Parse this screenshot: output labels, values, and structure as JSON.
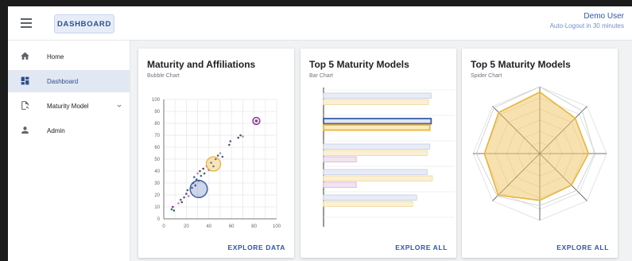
{
  "header": {
    "menu_icon": "hamburger-menu-icon",
    "dashboard_button": "DASHBOARD",
    "user_name": "Demo User",
    "auto_logout": "Auto-Logout in 30 minutes"
  },
  "sidebar": {
    "items": [
      {
        "label": "Home",
        "icon": "home-icon",
        "active": false
      },
      {
        "label": "Dashboard",
        "icon": "dashboard-icon",
        "active": true
      },
      {
        "label": "Maturity Model",
        "icon": "assessment-icon",
        "active": false,
        "expandable": true
      },
      {
        "label": "Admin",
        "icon": "person-icon",
        "active": false
      }
    ]
  },
  "cards": [
    {
      "title": "Maturity and Affiliations",
      "subtitle": "Bubble Chart",
      "action": "EXPLORE DATA"
    },
    {
      "title": "Top 5 Maturity Models",
      "subtitle": "Bar Chart",
      "action": "EXPLORE ALL"
    },
    {
      "title": "Top 5 Maturity Models",
      "subtitle": "Spider Chart",
      "action": "EXPLORE ALL"
    }
  ],
  "colors": {
    "accent": "#2d56a8",
    "blue_series": "#3c5ea8",
    "yellow_series": "#e8b53a",
    "purple": "#7b2a8f",
    "pink": "#c97ab7"
  },
  "chart_data": [
    {
      "type": "scatter",
      "xlim": [
        0,
        100
      ],
      "ylim": [
        0,
        100
      ],
      "x_ticks": [
        0,
        20,
        40,
        60,
        80,
        100
      ],
      "y_ticks": [
        0,
        10,
        20,
        30,
        40,
        50,
        60,
        70,
        80,
        90,
        100
      ],
      "grid": true,
      "points": [
        {
          "x": 7,
          "y": 8,
          "r": 1
        },
        {
          "x": 8,
          "y": 10,
          "r": 1
        },
        {
          "x": 9,
          "y": 7,
          "r": 1
        },
        {
          "x": 13,
          "y": 13,
          "r": 1
        },
        {
          "x": 15,
          "y": 16,
          "r": 1
        },
        {
          "x": 16,
          "y": 14,
          "r": 1
        },
        {
          "x": 18,
          "y": 18,
          "r": 1
        },
        {
          "x": 20,
          "y": 21,
          "r": 1
        },
        {
          "x": 21,
          "y": 24,
          "r": 1
        },
        {
          "x": 22,
          "y": 19,
          "r": 1
        },
        {
          "x": 25,
          "y": 26,
          "r": 1
        },
        {
          "x": 26,
          "y": 30,
          "r": 1
        },
        {
          "x": 27,
          "y": 35,
          "r": 1
        },
        {
          "x": 28,
          "y": 28,
          "r": 1
        },
        {
          "x": 29,
          "y": 33,
          "r": 1
        },
        {
          "x": 30,
          "y": 38,
          "r": 1
        },
        {
          "x": 31,
          "y": 32,
          "r": 1
        },
        {
          "x": 32,
          "y": 40,
          "r": 1
        },
        {
          "x": 33,
          "y": 36,
          "r": 1
        },
        {
          "x": 35,
          "y": 42,
          "r": 1
        },
        {
          "x": 36,
          "y": 38,
          "r": 1
        },
        {
          "x": 38,
          "y": 44,
          "r": 1
        },
        {
          "x": 40,
          "y": 41,
          "r": 1
        },
        {
          "x": 42,
          "y": 47,
          "r": 1
        },
        {
          "x": 44,
          "y": 44,
          "r": 1
        },
        {
          "x": 46,
          "y": 50,
          "r": 1
        },
        {
          "x": 48,
          "y": 53,
          "r": 1
        },
        {
          "x": 50,
          "y": 55,
          "r": 1
        },
        {
          "x": 52,
          "y": 52,
          "r": 1
        },
        {
          "x": 58,
          "y": 62,
          "r": 1
        },
        {
          "x": 59,
          "y": 65,
          "r": 1
        },
        {
          "x": 66,
          "y": 68,
          "r": 1
        },
        {
          "x": 68,
          "y": 70,
          "r": 1
        },
        {
          "x": 70,
          "y": 69,
          "r": 1
        },
        {
          "x": 44,
          "y": 46,
          "r": 5,
          "series": "yellow"
        },
        {
          "x": 31,
          "y": 25,
          "r": 6,
          "series": "blue"
        },
        {
          "x": 82,
          "y": 82,
          "r": 3,
          "series": "purple"
        }
      ]
    },
    {
      "type": "bar",
      "orientation": "horizontal",
      "groups": [
        {
          "values": [
            0.82,
            0.8
          ],
          "highlight": false
        },
        {
          "values": [
            0.82,
            0.81
          ],
          "highlight": true
        },
        {
          "values": [
            0.81,
            0.79,
            0.25
          ],
          "highlight": false
        },
        {
          "values": [
            0.79,
            0.83,
            0.25
          ],
          "highlight": false
        },
        {
          "values": [
            0.71,
            0.68
          ],
          "highlight": false
        }
      ]
    },
    {
      "type": "radar",
      "axes": 8,
      "series": [
        {
          "values": [
            0.92,
            0.75,
            0.73,
            0.67,
            0.7,
            0.88,
            0.83,
            0.87
          ],
          "color": "yellow"
        },
        {
          "values": [
            1.0,
            0.9,
            0.82,
            0.78,
            0.78,
            0.9,
            0.95,
            0.97
          ],
          "color": "gray"
        }
      ]
    }
  ]
}
